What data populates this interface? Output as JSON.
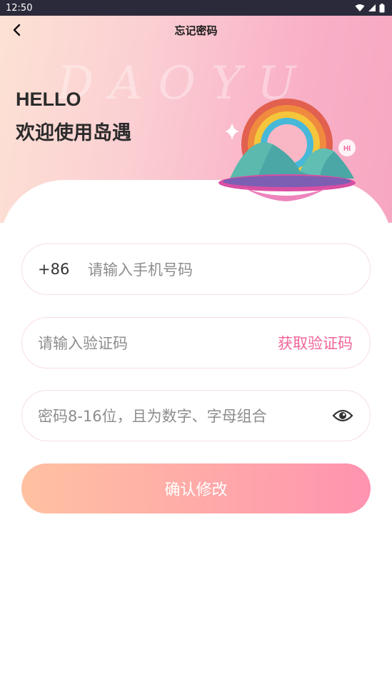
{
  "status_bar": {
    "time": "12:50"
  },
  "nav": {
    "title": "忘记密码"
  },
  "hero": {
    "watermark": "DAOYU",
    "hello": "HELLO",
    "welcome": "欢迎使用岛遇",
    "bubble_text": "HI"
  },
  "form": {
    "phone": {
      "prefix": "+86",
      "placeholder": "请输入手机号码"
    },
    "code": {
      "placeholder": "请输入验证码",
      "action": "获取验证码"
    },
    "password": {
      "placeholder": "密码8-16位，且为数字、字母组合"
    },
    "submit_label": "确认修改"
  },
  "icons": {
    "back": "chevron-left-icon",
    "eye": "eye-icon",
    "wifi": "wifi-icon",
    "signal": "signal-icon",
    "battery": "battery-icon"
  },
  "colors": {
    "accent": "#f0649a",
    "status_bar": "#2b2a3a",
    "button_start": "#ffc1a2",
    "button_end": "#ff93b0"
  }
}
